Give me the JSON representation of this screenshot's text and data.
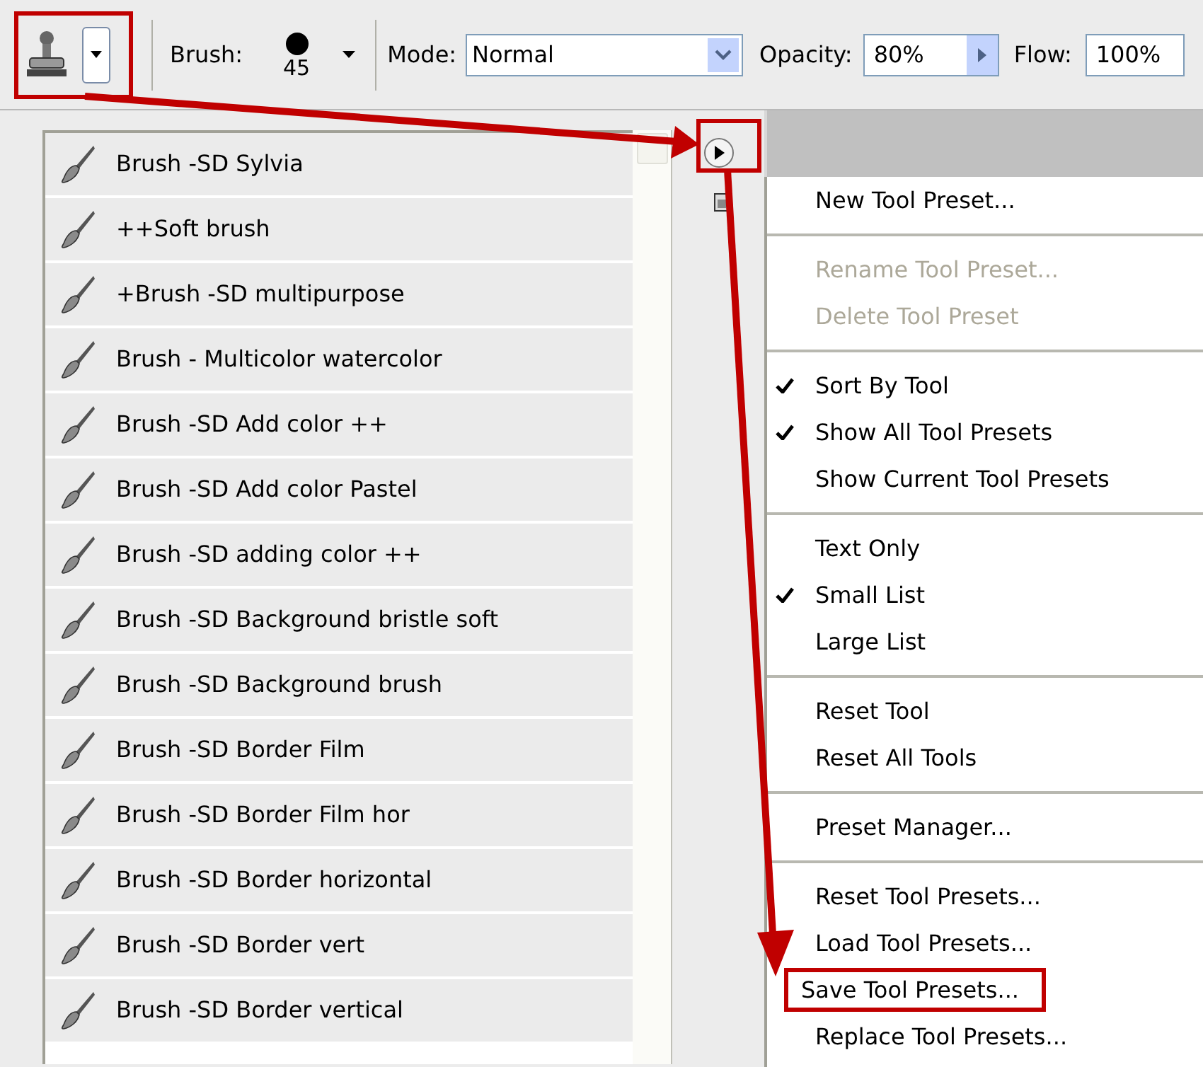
{
  "toolbar": {
    "brush": {
      "label": "Brush:",
      "size": "45"
    },
    "mode": {
      "label": "Mode:",
      "value": "Normal"
    },
    "opacity": {
      "label": "Opacity:",
      "value": "80%"
    },
    "flow": {
      "label": "Flow:",
      "value": "100%"
    }
  },
  "presets": [
    {
      "name": "Brush -SD Sylvia"
    },
    {
      "name": "++Soft brush"
    },
    {
      "name": "+Brush -SD multipurpose"
    },
    {
      "name": "Brush - Multicolor watercolor"
    },
    {
      "name": "Brush -SD Add color ++"
    },
    {
      "name": "Brush -SD Add color Pastel"
    },
    {
      "name": "Brush -SD adding color ++"
    },
    {
      "name": "Brush -SD Background bristle soft"
    },
    {
      "name": "Brush -SD Background brush"
    },
    {
      "name": "Brush -SD Border Film"
    },
    {
      "name": "Brush -SD Border Film hor"
    },
    {
      "name": "Brush -SD Border horizontal"
    },
    {
      "name": "Brush -SD Border vert"
    },
    {
      "name": "Brush -SD Border vertical"
    }
  ],
  "menu": {
    "sections": [
      {
        "items": [
          {
            "label": "New Tool Preset...",
            "checked": false,
            "disabled": false,
            "highlighted": false
          }
        ]
      },
      {
        "items": [
          {
            "label": "Rename Tool Preset...",
            "checked": false,
            "disabled": true,
            "highlighted": false
          },
          {
            "label": "Delete Tool Preset",
            "checked": false,
            "disabled": true,
            "highlighted": false
          }
        ]
      },
      {
        "items": [
          {
            "label": "Sort By Tool",
            "checked": true,
            "disabled": false,
            "highlighted": false
          },
          {
            "label": "Show All Tool Presets",
            "checked": true,
            "disabled": false,
            "highlighted": false
          },
          {
            "label": "Show Current Tool Presets",
            "checked": false,
            "disabled": false,
            "highlighted": false
          }
        ]
      },
      {
        "items": [
          {
            "label": "Text Only",
            "checked": false,
            "disabled": false,
            "highlighted": false
          },
          {
            "label": "Small List",
            "checked": true,
            "disabled": false,
            "highlighted": false
          },
          {
            "label": "Large List",
            "checked": false,
            "disabled": false,
            "highlighted": false
          }
        ]
      },
      {
        "items": [
          {
            "label": "Reset Tool",
            "checked": false,
            "disabled": false,
            "highlighted": false
          },
          {
            "label": "Reset All Tools",
            "checked": false,
            "disabled": false,
            "highlighted": false
          }
        ]
      },
      {
        "items": [
          {
            "label": "Preset Manager...",
            "checked": false,
            "disabled": false,
            "highlighted": false
          }
        ]
      },
      {
        "items": [
          {
            "label": "Reset Tool Presets...",
            "checked": false,
            "disabled": false,
            "highlighted": false
          },
          {
            "label": "Load Tool Presets...",
            "checked": false,
            "disabled": false,
            "highlighted": false
          },
          {
            "label": "Save Tool Presets...",
            "checked": false,
            "disabled": false,
            "highlighted": true
          },
          {
            "label": "Replace Tool Presets...",
            "checked": false,
            "disabled": false,
            "highlighted": false
          }
        ]
      }
    ]
  }
}
